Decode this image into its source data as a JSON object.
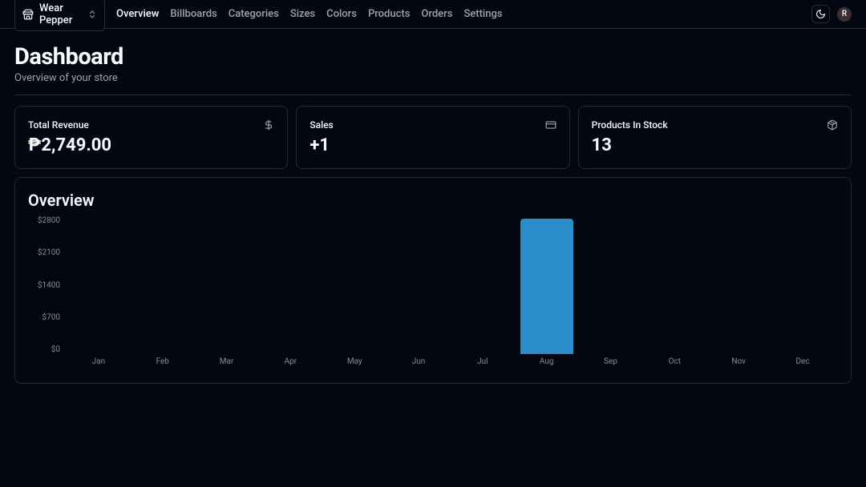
{
  "store": {
    "name": "Wear Pepper"
  },
  "nav": {
    "items": [
      "Overview",
      "Billboards",
      "Categories",
      "Sizes",
      "Colors",
      "Products",
      "Orders",
      "Settings"
    ],
    "active": "Overview"
  },
  "avatar": {
    "initial": "R"
  },
  "page": {
    "title": "Dashboard",
    "subtitle": "Overview of your store"
  },
  "cards": {
    "revenue": {
      "label": "Total Revenue",
      "value": "₱2,749.00"
    },
    "sales": {
      "label": "Sales",
      "value": "+1"
    },
    "stock": {
      "label": "Products In Stock",
      "value": "13"
    }
  },
  "overview": {
    "title": "Overview"
  },
  "chart_data": {
    "type": "bar",
    "categories": [
      "Jan",
      "Feb",
      "Mar",
      "Apr",
      "May",
      "Jun",
      "Jul",
      "Aug",
      "Sep",
      "Oct",
      "Nov",
      "Dec"
    ],
    "values": [
      0,
      0,
      0,
      0,
      0,
      0,
      0,
      2749,
      0,
      0,
      0,
      0
    ],
    "y_ticks": [
      "$2800",
      "$2100",
      "$1400",
      "$700",
      "$0"
    ],
    "ylim": [
      0,
      2800
    ],
    "title": "Overview",
    "xlabel": "",
    "ylabel": ""
  }
}
